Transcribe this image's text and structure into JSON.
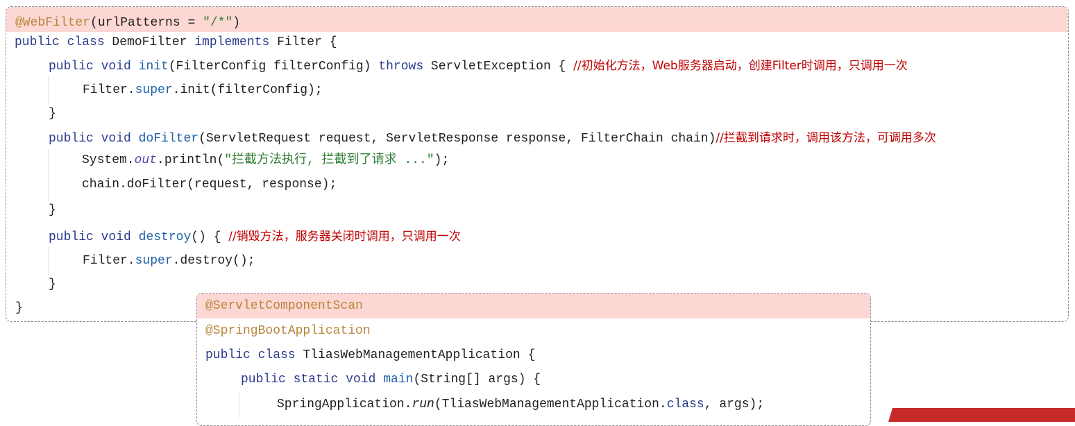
{
  "filter_code": {
    "annotation": "@WebFilter",
    "annotation_args": "(urlPatterns = ",
    "annotation_string": "\"/*\"",
    "annotation_close": ")",
    "class_kw": "public class",
    "class_name": " DemoFilter ",
    "implements_kw": "implements",
    "interface_rest": " Filter {",
    "init_mod": "public void",
    "init_name": "init",
    "init_params": "(FilterConfig filterConfig) ",
    "throws_kw": "throws",
    "throws_rest": " ServletException { ",
    "init_comment": "//初始化方法，Web服务器启动，创建Filter时调用，只调用一次",
    "init_body_a": "Filter.",
    "init_body_super": "super",
    "init_body_b": ".init(filterConfig);",
    "brace_close": "}",
    "dofilter_mod": "public void",
    "dofilter_name": "doFilter",
    "dofilter_params": "(ServletRequest request, ServletResponse response, FilterChain chain)",
    "dofilter_comment": "//拦截到请求时，调用该方法，可调用多次",
    "sysout_a": "System.",
    "sysout_out": "out",
    "sysout_b": ".println(",
    "sysout_string": "\"拦截方法执行, 拦截到了请求 ...\"",
    "sysout_c": ");",
    "chain_call": "chain.doFilter(request, response);",
    "destroy_mod": "public void",
    "destroy_name": "destroy",
    "destroy_params": "() { ",
    "destroy_comment": "//销毁方法，服务器关闭时调用，只调用一次",
    "destroy_body_a": "Filter.",
    "destroy_body_super": "super",
    "destroy_body_b": ".destroy();"
  },
  "app_code": {
    "annotation_scan": "@ServletComponentScan",
    "annotation_boot": "@SpringBootApplication",
    "class_kw": "public class",
    "class_rest": " TliasWebManagementApplication {",
    "main_mod": "public static void",
    "main_name": "main",
    "main_params": "(String[] args) {",
    "run_a": "SpringApplication.",
    "run_name": "run",
    "run_b": "(TliasWebManagementApplication.",
    "run_class_kw": "class",
    "run_c": ", args);"
  },
  "colors": {
    "keyword": "#2b3a8c",
    "method": "#1d5fa8",
    "annotation": "#b8863b",
    "string": "#2f7d32",
    "comment": "#c00000",
    "highlight": "#fcd7d3"
  }
}
